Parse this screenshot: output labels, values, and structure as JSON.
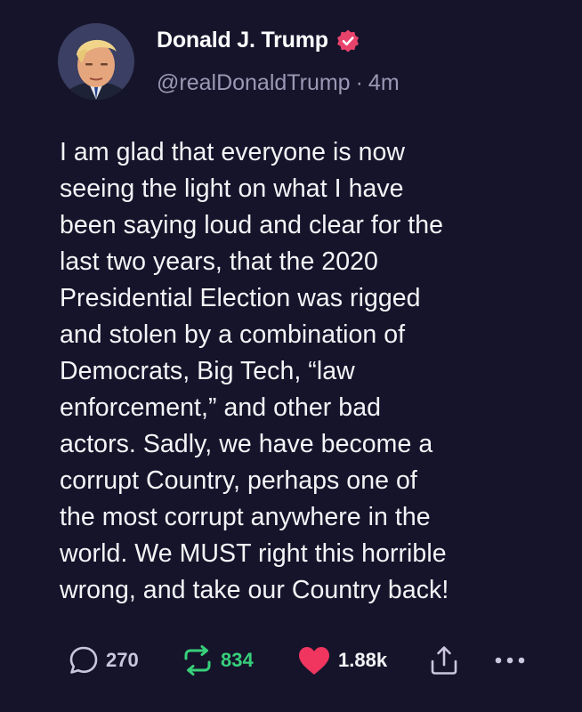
{
  "post": {
    "author": {
      "display_name": "Donald J. Trump",
      "handle": "@realDonaldTrump",
      "separator": "·",
      "time": "4m",
      "verified": true,
      "avatar_icon": "profile-photo"
    },
    "text": "I am glad that everyone is now\nseeing the light on what I have\nbeen saying loud and clear for the\nlast two years, that the 2020\nPresidential Election was rigged\nand stolen by a combination of\nDemocrats, Big Tech, “law\nenforcement,” and other bad\nactors. Sadly, we have become a\ncorrupt Country, perhaps one of\nthe most corrupt anywhere in the\nworld. We MUST right this horrible\nwrong, and take our Country back!",
    "actions": {
      "replies": "270",
      "retruths": "834",
      "likes": "1.88k",
      "reply_icon": "speech-bubble-icon",
      "retruth_icon": "retruth-arrows-icon",
      "like_icon": "heart-icon",
      "share_icon": "share-icon",
      "more_icon": "ellipsis-icon"
    }
  },
  "colors": {
    "background": "#16142b",
    "verified_badge": "#e8436b",
    "retruth_green": "#37d07a",
    "like_red": "#f0365f",
    "muted_text": "#9b98b5"
  }
}
